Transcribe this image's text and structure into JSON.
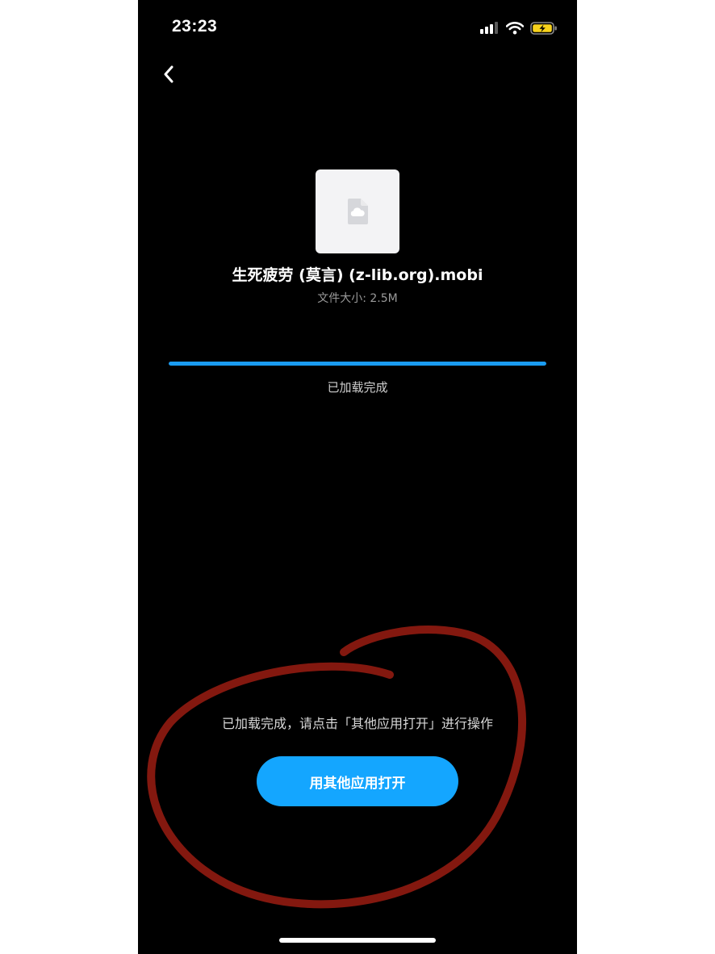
{
  "status_bar": {
    "time": "23:23",
    "icons": [
      "signal-icon",
      "wifi-icon",
      "battery-charging-icon"
    ]
  },
  "nav": {
    "back_icon": "chevron-left-icon"
  },
  "file": {
    "icon": "cloud-file-icon",
    "name": "生死疲劳 (莫言) (z-lib.org).mobi",
    "size_label": "文件大小: 2.5M"
  },
  "progress": {
    "fraction": 1.0,
    "label": "已加载完成",
    "color": "#1a9cf2"
  },
  "hint": "已加载完成，请点击「其他应用打开」进行操作",
  "open_button": {
    "label": "用其他应用打开",
    "color": "#14a6ff"
  },
  "annotation": {
    "color": "#8e1a10"
  }
}
